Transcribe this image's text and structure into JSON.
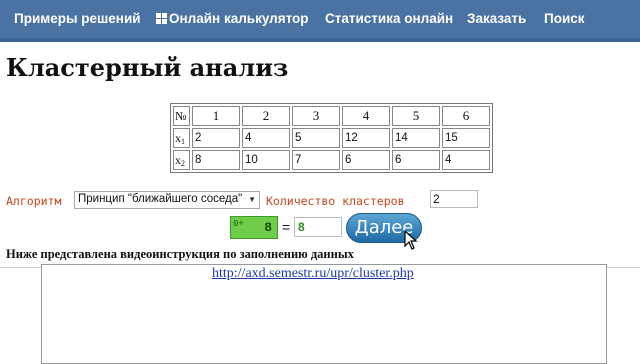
{
  "nav": {
    "items": [
      "Примеры решений",
      "Онлайн калькулятор",
      "Статистика онлайн",
      "Заказать",
      "Поиск"
    ],
    "icon": "calculator-icon"
  },
  "page_title": "Кластерный анализ",
  "table": {
    "header": [
      "№",
      "1",
      "2",
      "3",
      "4",
      "5",
      "6"
    ],
    "rows": [
      {
        "label": "x",
        "sub": "1",
        "values": [
          "2",
          "4",
          "5",
          "12",
          "14",
          "15"
        ]
      },
      {
        "label": "x",
        "sub": "2",
        "values": [
          "8",
          "10",
          "7",
          "6",
          "6",
          "4"
        ]
      }
    ]
  },
  "controls": {
    "algorithm_label": "Алгоритм",
    "algorithm_value": "Принцип \"ближайшего соседа\"",
    "clusters_label": "Количество кластеров",
    "clusters_value": "2"
  },
  "captcha": {
    "small": "0+",
    "big": "8",
    "eq": "=",
    "answer": "8",
    "next_label": "Далее"
  },
  "note": "Ниже представлена видеоинструкция по заполнению данных",
  "video_link": "http://axd.semestr.ru/upr/cluster.php",
  "colors": {
    "nav_bg": "#4a73a4",
    "accent_orange": "#c8441c",
    "captcha_green": "#6fcc48",
    "button_blue": "#1f6aa5"
  }
}
